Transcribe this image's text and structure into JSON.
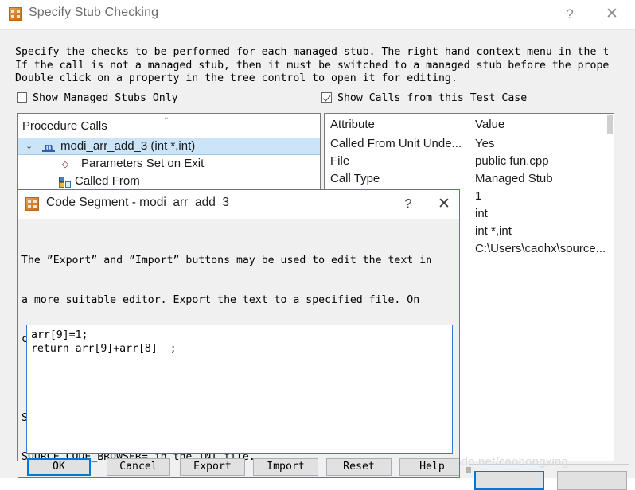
{
  "window": {
    "title": "Specify Stub Checking",
    "icon": "app-grid-icon",
    "help_glyph": "?",
    "close_glyph": "✕"
  },
  "description": [
    "Specify the checks to be performed for each managed stub. The right hand context menu in the t",
    "If the call is not a managed stub, then it must be switched to a managed stub before the prope",
    "Double click on a property in the tree control to open it for editing."
  ],
  "checkboxes": [
    {
      "label": "Show Managed Stubs Only",
      "checked": false
    },
    {
      "label": "Show Calls from this Test Case",
      "checked": true
    }
  ],
  "tree": {
    "header": "Procedure Calls",
    "scroll_up_glyph": "⌄",
    "rows": [
      {
        "label": "modi_arr_add_3 (int *,int)",
        "icon": "module-m-icon",
        "expander": "⌄",
        "selected": true,
        "indent": 0
      },
      {
        "label": "Parameters Set on Exit",
        "icon": "diamond-icon",
        "expander": "",
        "selected": false,
        "indent": 1
      },
      {
        "label": "Called From",
        "icon": "called-from-icon",
        "expander": "",
        "selected": false,
        "indent": 1
      }
    ]
  },
  "attributes": {
    "columns": [
      "Attribute",
      "Value"
    ],
    "rows": [
      {
        "name": "Called From Unit Unde...",
        "value": "Yes"
      },
      {
        "name": "File",
        "value": "public fun.cpp"
      },
      {
        "name": "Call Type",
        "value": "Managed Stub"
      },
      {
        "name": "Number of Calls",
        "value": "1"
      },
      {
        "name": "",
        "value": "int"
      },
      {
        "name": "",
        "value": "int *,int"
      },
      {
        "name": "",
        "value": "C:\\Users\\caohx\\source..."
      }
    ]
  },
  "code_dialog": {
    "title": "Code Segment - modi_arr_add_3",
    "icon": "app-grid-icon",
    "help_glyph": "?",
    "close_glyph": "✕",
    "body": [
      "The ”Export” and ”Import” buttons may be used to edit the text in",
      "a more suitable editor. Export the text to a specified file. On",
      "completion import the changes back into this edit control."
    ],
    "body2": [
      "Specify the required browser with the profile string",
      "SOURCE_CODE_BROWSER= in the INI file."
    ],
    "editor_value": "arr[9]=1;\nreturn arr[9]+arr[8]  ;",
    "buttons": [
      {
        "label": "OK",
        "default": true
      },
      {
        "label": "Cancel",
        "default": false
      },
      {
        "label": "Export",
        "default": false
      },
      {
        "label": "Import",
        "default": false
      },
      {
        "label": "Reset",
        "default": false
      },
      {
        "label": "Help",
        "default": false
      }
    ]
  },
  "watermark": "https://blog.csdn.net/caohongxing",
  "colors": {
    "accent": "#0078d7",
    "selection": "#cce4f7",
    "icon_orange": "#d2822e",
    "window_bg": "#f0f0f0"
  }
}
